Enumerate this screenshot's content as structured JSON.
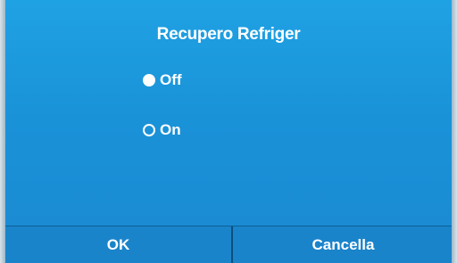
{
  "screen": {
    "title": "Recupero Refriger",
    "background_color": "#1fa2e4"
  },
  "options": [
    {
      "label": "Off",
      "selected": true
    },
    {
      "label": "On",
      "selected": false
    }
  ],
  "buttons": {
    "ok_label": "OK",
    "cancel_label": "Cancella"
  }
}
